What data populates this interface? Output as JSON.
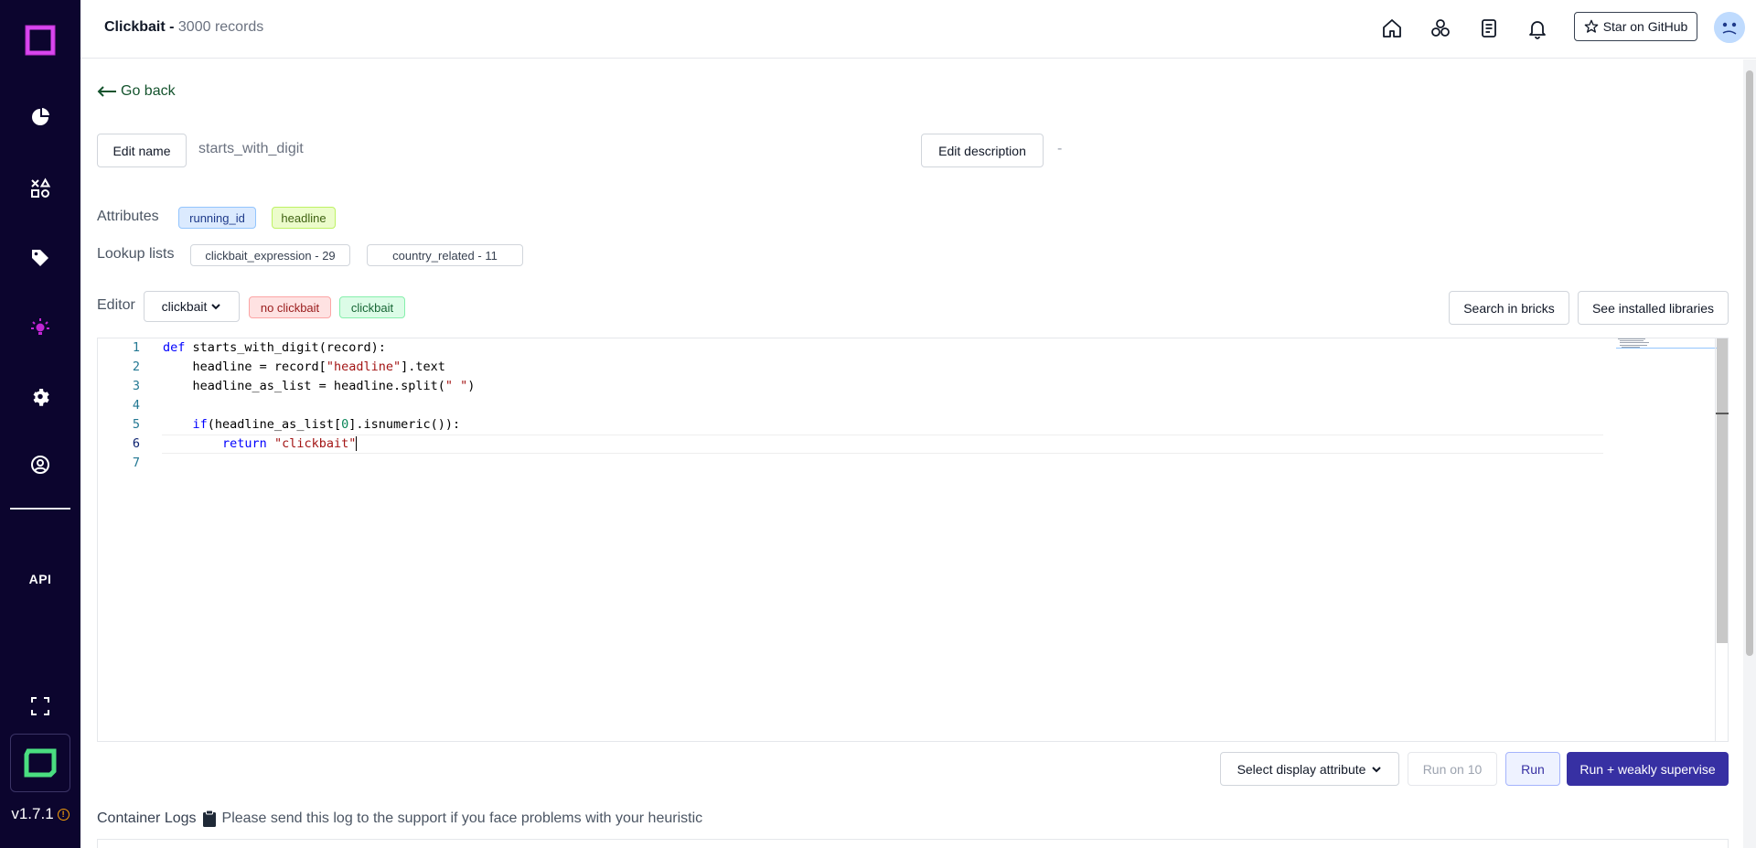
{
  "sidebar": {
    "api_label": "API",
    "version": "v1.7.1"
  },
  "header": {
    "project_name": "Clickbait - ",
    "record_count": "3000 records",
    "github_label": "Star on GitHub"
  },
  "page": {
    "go_back": "Go back",
    "edit_name_label": "Edit name",
    "heuristic_name": "starts_with_digit",
    "edit_description_label": "Edit description",
    "description": "-",
    "attributes_label": "Attributes",
    "attributes": [
      "running_id",
      "headline"
    ],
    "lookup_label": "Lookup lists",
    "lookup_lists": [
      "clickbait_expression - 29",
      "country_related - 11"
    ],
    "editor_label": "Editor",
    "selected_label": "clickbait",
    "labels": [
      "no clickbait",
      "clickbait"
    ],
    "search_bricks": "Search in bricks",
    "installed_libs": "See installed libraries",
    "select_display": "Select display attribute",
    "run_on_10": "Run on 10",
    "run": "Run",
    "run_weak": "Run + weakly supervise",
    "logs_title": "Container Logs",
    "logs_hint": "Please send this log to the support if you face problems with your heuristic"
  },
  "code": {
    "line_numbers": [
      "1",
      "2",
      "3",
      "4",
      "5",
      "6",
      "7"
    ],
    "l1_kw": "def",
    "l1_rest": " starts_with_digit(record):",
    "l2_a": "    headline = record[",
    "l2_str": "\"headline\"",
    "l2_b": "].text",
    "l3_a": "    headline_as_list = headline.split(",
    "l3_str": "\" \"",
    "l3_b": ")",
    "l5_indent": "    ",
    "l5_kw": "if",
    "l5_a": "(headline_as_list[",
    "l5_num": "0",
    "l5_b": "].isnumeric()):",
    "l6_indent": "        ",
    "l6_kw": "return",
    "l6_sp": " ",
    "l6_str": "\"clickbait\""
  },
  "colors": {
    "sidebar_bg": "#0c052e",
    "accent": "#3730a3",
    "brand_pink": "#d946ef",
    "brand_green": "#4ade80"
  }
}
